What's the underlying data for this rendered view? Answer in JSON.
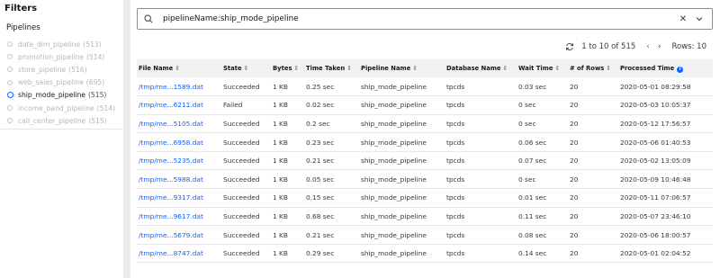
{
  "sidebar": {
    "title": "Filters",
    "section_title": "Pipelines",
    "pipelines": [
      {
        "name": "date_dim_pipeline",
        "count": "(513)",
        "selected": false
      },
      {
        "name": "promotion_pipeline",
        "count": "(514)",
        "selected": false
      },
      {
        "name": "store_pipeline",
        "count": "(516)",
        "selected": false
      },
      {
        "name": "web_sales_pipeline",
        "count": "(695)",
        "selected": false
      },
      {
        "name": "ship_mode_pipeline",
        "count": "(515)",
        "selected": true
      },
      {
        "name": "income_band_pipeline",
        "count": "(514)",
        "selected": false
      },
      {
        "name": "call_center_pipeline",
        "count": "(515)",
        "selected": false
      }
    ]
  },
  "search": {
    "value": "pipelineName:ship_mode_pipeline",
    "icon": "search-icon",
    "clear_icon": "close-icon",
    "dropdown_icon": "chevron-down-icon"
  },
  "pager": {
    "range": "1 to 10 of 515",
    "rows_label": "Rows: 10",
    "refresh_icon": "refresh-icon"
  },
  "table": {
    "headers": [
      "File Name",
      "State",
      "Bytes",
      "Time Taken",
      "Pipeline Name",
      "Database Name",
      "Wait Time",
      "# of Rows",
      "Processed Time"
    ],
    "rows": [
      [
        "/tmp/me...1589.dat",
        "Succeeded",
        "1 KB",
        "0.25 sec",
        "ship_mode_pipeline",
        "tpcds",
        "0.03 sec",
        "20",
        "2020-05-01 08:29:58"
      ],
      [
        "/tmp/me...6211.dat",
        "Failed",
        "1 KB",
        "0.02 sec",
        "ship_mode_pipeline",
        "tpcds",
        "0 sec",
        "20",
        "2020-05-03 10:05:37"
      ],
      [
        "/tmp/me...5105.dat",
        "Succeeded",
        "1 KB",
        "0.2 sec",
        "ship_mode_pipeline",
        "tpcds",
        "0 sec",
        "20",
        "2020-05-12 17:56:57"
      ],
      [
        "/tmp/me...6958.dat",
        "Succeeded",
        "1 KB",
        "0.23 sec",
        "ship_mode_pipeline",
        "tpcds",
        "0.06 sec",
        "20",
        "2020-05-06 01:40:53"
      ],
      [
        "/tmp/me...5235.dat",
        "Succeeded",
        "1 KB",
        "0.21 sec",
        "ship_mode_pipeline",
        "tpcds",
        "0.07 sec",
        "20",
        "2020-05-02 13:05:09"
      ],
      [
        "/tmp/me...5988.dat",
        "Succeeded",
        "1 KB",
        "0.05 sec",
        "ship_mode_pipeline",
        "tpcds",
        "0 sec",
        "20",
        "2020-05-09 10:46:48"
      ],
      [
        "/tmp/me...9317.dat",
        "Succeeded",
        "1 KB",
        "0.15 sec",
        "ship_mode_pipeline",
        "tpcds",
        "0.01 sec",
        "20",
        "2020-05-11 07:06:57"
      ],
      [
        "/tmp/me...9617.dat",
        "Succeeded",
        "1 KB",
        "0.68 sec",
        "ship_mode_pipeline",
        "tpcds",
        "0.11 sec",
        "20",
        "2020-05-07 23:46:10"
      ],
      [
        "/tmp/me...5679.dat",
        "Succeeded",
        "1 KB",
        "0.21 sec",
        "ship_mode_pipeline",
        "tpcds",
        "0.08 sec",
        "20",
        "2020-05-06 18:00:57"
      ],
      [
        "/tmp/me...8747.dat",
        "Succeeded",
        "1 KB",
        "0.29 sec",
        "ship_mode_pipeline",
        "tpcds",
        "0.14 sec",
        "20",
        "2020-05-01 02:04:52"
      ]
    ]
  },
  "colors": {
    "accent": "#0f62fe",
    "sidebar_gutter": "#ebebeb",
    "header_bg": "#f2f2f2"
  }
}
